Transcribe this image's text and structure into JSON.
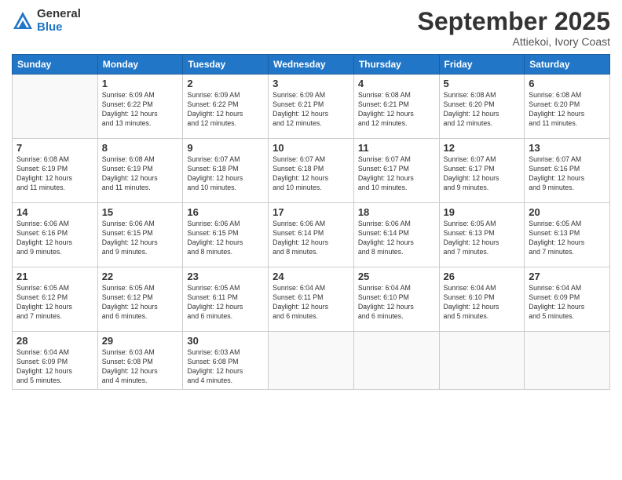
{
  "header": {
    "logo": {
      "general": "General",
      "blue": "Blue"
    },
    "title": "September 2025",
    "location": "Attiekoi, Ivory Coast"
  },
  "calendar": {
    "days": [
      "Sunday",
      "Monday",
      "Tuesday",
      "Wednesday",
      "Thursday",
      "Friday",
      "Saturday"
    ],
    "weeks": [
      [
        {
          "day": null,
          "info": null
        },
        {
          "day": "1",
          "info": "Sunrise: 6:09 AM\nSunset: 6:22 PM\nDaylight: 12 hours\nand 13 minutes."
        },
        {
          "day": "2",
          "info": "Sunrise: 6:09 AM\nSunset: 6:22 PM\nDaylight: 12 hours\nand 12 minutes."
        },
        {
          "day": "3",
          "info": "Sunrise: 6:09 AM\nSunset: 6:21 PM\nDaylight: 12 hours\nand 12 minutes."
        },
        {
          "day": "4",
          "info": "Sunrise: 6:08 AM\nSunset: 6:21 PM\nDaylight: 12 hours\nand 12 minutes."
        },
        {
          "day": "5",
          "info": "Sunrise: 6:08 AM\nSunset: 6:20 PM\nDaylight: 12 hours\nand 12 minutes."
        },
        {
          "day": "6",
          "info": "Sunrise: 6:08 AM\nSunset: 6:20 PM\nDaylight: 12 hours\nand 11 minutes."
        }
      ],
      [
        {
          "day": "7",
          "info": "Sunrise: 6:08 AM\nSunset: 6:19 PM\nDaylight: 12 hours\nand 11 minutes."
        },
        {
          "day": "8",
          "info": "Sunrise: 6:08 AM\nSunset: 6:19 PM\nDaylight: 12 hours\nand 11 minutes."
        },
        {
          "day": "9",
          "info": "Sunrise: 6:07 AM\nSunset: 6:18 PM\nDaylight: 12 hours\nand 10 minutes."
        },
        {
          "day": "10",
          "info": "Sunrise: 6:07 AM\nSunset: 6:18 PM\nDaylight: 12 hours\nand 10 minutes."
        },
        {
          "day": "11",
          "info": "Sunrise: 6:07 AM\nSunset: 6:17 PM\nDaylight: 12 hours\nand 10 minutes."
        },
        {
          "day": "12",
          "info": "Sunrise: 6:07 AM\nSunset: 6:17 PM\nDaylight: 12 hours\nand 9 minutes."
        },
        {
          "day": "13",
          "info": "Sunrise: 6:07 AM\nSunset: 6:16 PM\nDaylight: 12 hours\nand 9 minutes."
        }
      ],
      [
        {
          "day": "14",
          "info": "Sunrise: 6:06 AM\nSunset: 6:16 PM\nDaylight: 12 hours\nand 9 minutes."
        },
        {
          "day": "15",
          "info": "Sunrise: 6:06 AM\nSunset: 6:15 PM\nDaylight: 12 hours\nand 9 minutes."
        },
        {
          "day": "16",
          "info": "Sunrise: 6:06 AM\nSunset: 6:15 PM\nDaylight: 12 hours\nand 8 minutes."
        },
        {
          "day": "17",
          "info": "Sunrise: 6:06 AM\nSunset: 6:14 PM\nDaylight: 12 hours\nand 8 minutes."
        },
        {
          "day": "18",
          "info": "Sunrise: 6:06 AM\nSunset: 6:14 PM\nDaylight: 12 hours\nand 8 minutes."
        },
        {
          "day": "19",
          "info": "Sunrise: 6:05 AM\nSunset: 6:13 PM\nDaylight: 12 hours\nand 7 minutes."
        },
        {
          "day": "20",
          "info": "Sunrise: 6:05 AM\nSunset: 6:13 PM\nDaylight: 12 hours\nand 7 minutes."
        }
      ],
      [
        {
          "day": "21",
          "info": "Sunrise: 6:05 AM\nSunset: 6:12 PM\nDaylight: 12 hours\nand 7 minutes."
        },
        {
          "day": "22",
          "info": "Sunrise: 6:05 AM\nSunset: 6:12 PM\nDaylight: 12 hours\nand 6 minutes."
        },
        {
          "day": "23",
          "info": "Sunrise: 6:05 AM\nSunset: 6:11 PM\nDaylight: 12 hours\nand 6 minutes."
        },
        {
          "day": "24",
          "info": "Sunrise: 6:04 AM\nSunset: 6:11 PM\nDaylight: 12 hours\nand 6 minutes."
        },
        {
          "day": "25",
          "info": "Sunrise: 6:04 AM\nSunset: 6:10 PM\nDaylight: 12 hours\nand 6 minutes."
        },
        {
          "day": "26",
          "info": "Sunrise: 6:04 AM\nSunset: 6:10 PM\nDaylight: 12 hours\nand 5 minutes."
        },
        {
          "day": "27",
          "info": "Sunrise: 6:04 AM\nSunset: 6:09 PM\nDaylight: 12 hours\nand 5 minutes."
        }
      ],
      [
        {
          "day": "28",
          "info": "Sunrise: 6:04 AM\nSunset: 6:09 PM\nDaylight: 12 hours\nand 5 minutes."
        },
        {
          "day": "29",
          "info": "Sunrise: 6:03 AM\nSunset: 6:08 PM\nDaylight: 12 hours\nand 4 minutes."
        },
        {
          "day": "30",
          "info": "Sunrise: 6:03 AM\nSunset: 6:08 PM\nDaylight: 12 hours\nand 4 minutes."
        },
        {
          "day": null,
          "info": null
        },
        {
          "day": null,
          "info": null
        },
        {
          "day": null,
          "info": null
        },
        {
          "day": null,
          "info": null
        }
      ]
    ]
  }
}
